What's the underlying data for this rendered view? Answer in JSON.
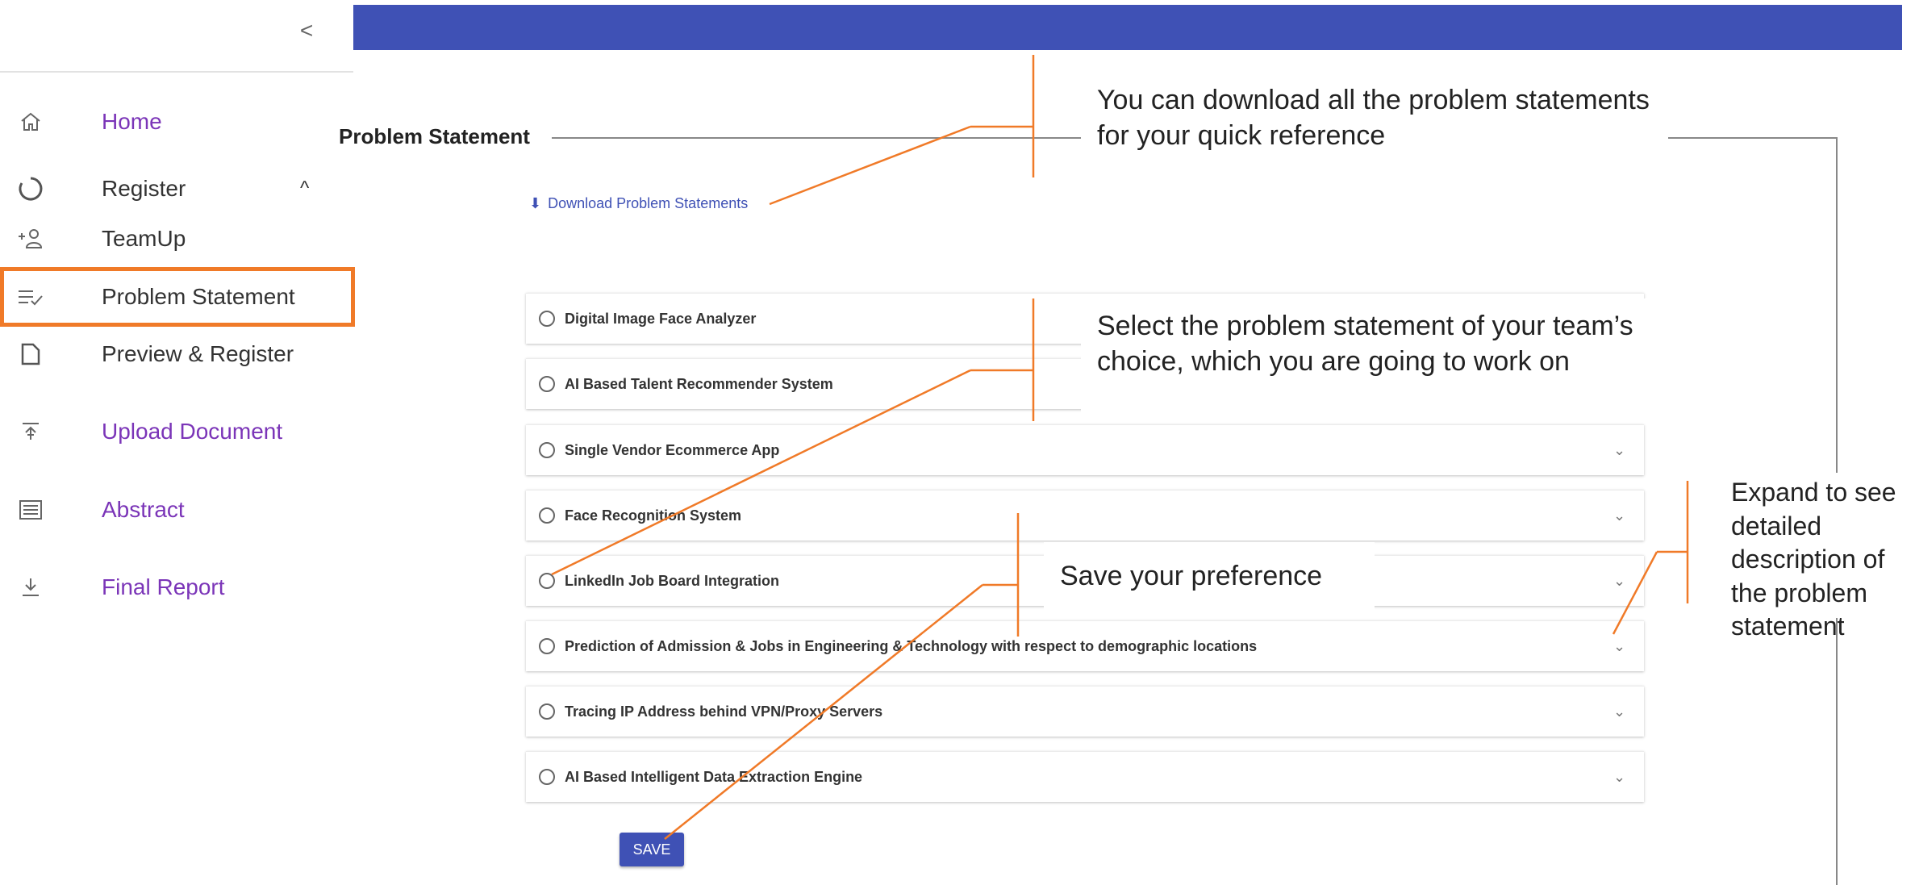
{
  "sidebar": {
    "collapse_label": "<",
    "items": [
      {
        "label": "Home",
        "icon": "home-icon"
      },
      {
        "label": "Register",
        "icon": "circle-icon",
        "chevron": "^"
      },
      {
        "label": "TeamUp",
        "icon": "add-person-icon"
      },
      {
        "label": "Problem Statement",
        "icon": "list-check-icon"
      },
      {
        "label": "Preview & Register",
        "icon": "document-icon"
      },
      {
        "label": "Upload Document",
        "icon": "upload-icon"
      },
      {
        "label": "Abstract",
        "icon": "list-icon"
      },
      {
        "label": "Final Report",
        "icon": "download-icon"
      }
    ]
  },
  "main": {
    "section_title": "Problem Statement",
    "download_label": "Download Problem Statements",
    "problem_statements": [
      "Digital Image Face Analyzer",
      "AI Based Talent Recommender System",
      "Single Vendor Ecommerce App",
      "Face Recognition System",
      "LinkedIn Job Board Integration",
      "Prediction of Admission & Jobs in Engineering & Technology with respect to demographic locations",
      "Tracing IP Address behind VPN/Proxy Servers",
      "AI Based Intelligent Data Extraction Engine"
    ],
    "expand_glyph": "⌄",
    "save_label": "SAVE"
  },
  "callouts": {
    "download": "You can download all the problem statements for your quick reference",
    "select": "Select the problem statement of your team’s choice, which you are going to work on",
    "save": "Save your preference",
    "expand": "Expand to see detailed description of the problem statement"
  },
  "colors": {
    "accent": "#3f51b5",
    "annotation": "#f07a28",
    "nav_purple": "#7b35b8"
  }
}
